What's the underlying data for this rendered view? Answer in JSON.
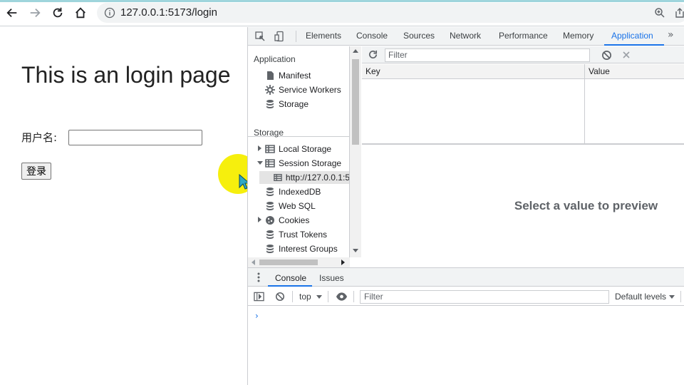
{
  "browser": {
    "url": "127.0.0.1:5173/login"
  },
  "page": {
    "heading": "This is an login page",
    "username_label": "用户名:",
    "username_value": "",
    "login_button": "登录"
  },
  "devtools": {
    "tabs": [
      "Elements",
      "Console",
      "Sources",
      "Network",
      "Performance",
      "Memory",
      "Application"
    ],
    "active_tab": "Application",
    "more": "»",
    "sidebar": {
      "application_header": "Application",
      "application_items": [
        "Manifest",
        "Service Workers",
        "Storage"
      ],
      "storage_header": "Storage",
      "storage_items": [
        "Local Storage",
        "Session Storage",
        "http://127.0.0.1:5",
        "IndexedDB",
        "Web SQL",
        "Cookies",
        "Trust Tokens",
        "Interest Groups"
      ]
    },
    "main": {
      "filter_placeholder": "Filter",
      "columns": [
        "Key",
        "Value"
      ],
      "preview_text": "Select a value to preview"
    },
    "drawer": {
      "tabs": [
        "Console",
        "Issues"
      ],
      "active_tab": "Console",
      "context": "top",
      "filter_placeholder": "Filter",
      "levels": "Default levels",
      "prompt": "›"
    }
  },
  "colors": {
    "accent": "#1a73e8",
    "highlight": "#f6ee00"
  }
}
